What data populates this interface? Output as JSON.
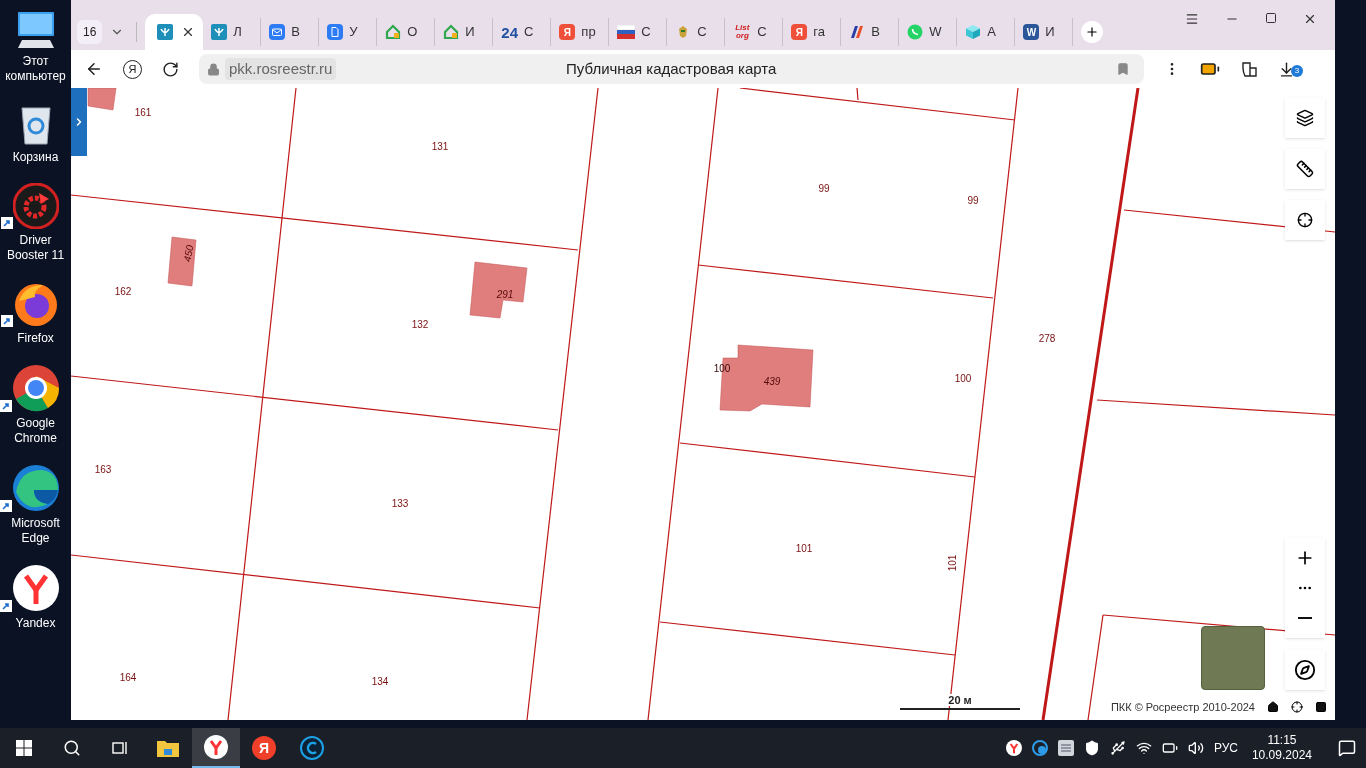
{
  "desktop_icons": [
    {
      "label": "Этот компьютер",
      "kind": "computer",
      "shortcut": false
    },
    {
      "label": "Корзина",
      "kind": "bin",
      "shortcut": false
    },
    {
      "label": "Driver Booster 11",
      "kind": "booster",
      "shortcut": true
    },
    {
      "label": "Firefox",
      "kind": "firefox",
      "shortcut": true
    },
    {
      "label": "Google Chrome",
      "kind": "chrome",
      "shortcut": true
    },
    {
      "label": "Microsoft Edge",
      "kind": "edge",
      "shortcut": true
    },
    {
      "label": "Yandex",
      "kind": "ybrowser",
      "shortcut": true
    }
  ],
  "browser": {
    "tab_count": "16",
    "tabs": [
      {
        "kind": "gosuslugi",
        "selected": true
      },
      {
        "kind": "gosuslugi",
        "label": "Л",
        "selected": false
      },
      {
        "kind": "mail",
        "label": "В",
        "selected": false
      },
      {
        "kind": "doc",
        "label": "У",
        "selected": false
      },
      {
        "kind": "house",
        "label": "О",
        "selected": false
      },
      {
        "kind": "house",
        "label": "И",
        "selected": false
      },
      {
        "kind": "text",
        "icon_text": "24",
        "label": "С",
        "selected": false
      },
      {
        "kind": "yandex",
        "icon_text": "Я",
        "label": "пр",
        "selected": false
      },
      {
        "kind": "flag",
        "label": "С",
        "selected": false
      },
      {
        "kind": "emblem",
        "label": "С",
        "selected": false
      },
      {
        "kind": "listorg",
        "icon_text": "List org",
        "label": "С",
        "selected": false
      },
      {
        "kind": "yandex",
        "icon_text": "Я",
        "label": "га",
        "selected": false
      },
      {
        "kind": "bank",
        "label": "В",
        "selected": false
      },
      {
        "kind": "whatsapp",
        "label": "W",
        "selected": false
      },
      {
        "kind": "box",
        "label": "А",
        "selected": false
      },
      {
        "kind": "word",
        "icon_text": "W",
        "label": "И",
        "selected": false
      }
    ],
    "toolbar": {
      "yandex_glyph": "Я",
      "url": "pkk.rosreestr.ru",
      "page_title": "Публичная кадастровая карта",
      "downloads_badge": "3"
    }
  },
  "map": {
    "parcels": [
      {
        "label": "161"
      },
      {
        "label": "131"
      },
      {
        "label": "99"
      },
      {
        "label": "99"
      },
      {
        "label": "162"
      },
      {
        "label": "132"
      },
      {
        "label": "100"
      },
      {
        "label": "278"
      },
      {
        "label": "163"
      },
      {
        "label": "133"
      },
      {
        "label": "101"
      },
      {
        "label": "101"
      },
      {
        "label": "164"
      },
      {
        "label": "134"
      }
    ],
    "buildings": [
      {
        "label": "450"
      },
      {
        "label": "291"
      },
      {
        "label": "439"
      }
    ],
    "building_100_label": "100",
    "scale": "20 м",
    "attribution": "ПКК © Росреестр 2010-2024"
  },
  "taskbar": {
    "apps": [
      {
        "kind": "folder",
        "selected": false
      },
      {
        "kind": "ybrowser",
        "selected": true
      },
      {
        "kind": "yandex",
        "icon_text": "Я",
        "selected": false
      },
      {
        "kind": "ccleaner",
        "selected": false
      }
    ],
    "language": "РУС",
    "time": "11:15",
    "date": "10.09.2024"
  }
}
